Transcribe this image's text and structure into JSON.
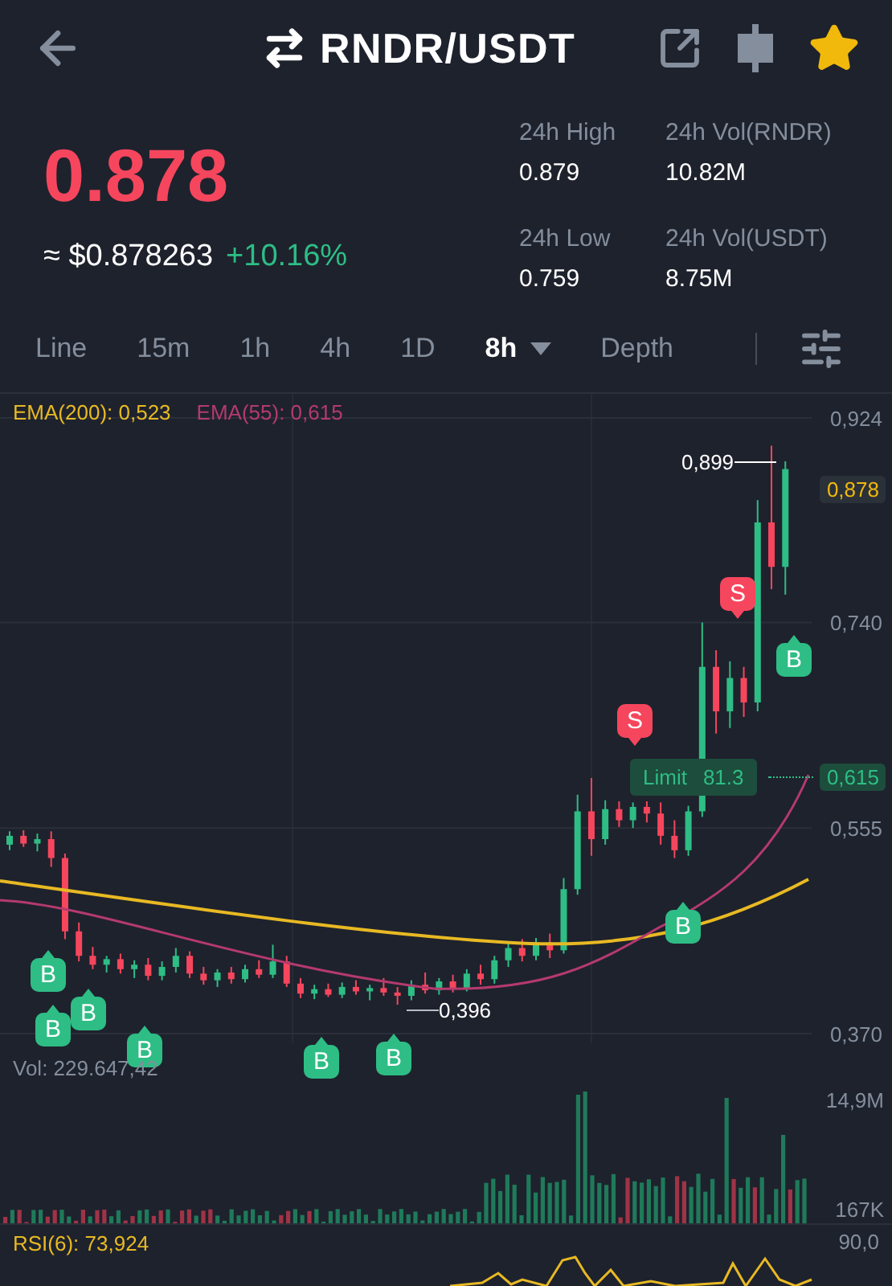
{
  "header": {
    "title": "RNDR/USDT",
    "favorite": true
  },
  "price": {
    "last": "0.878",
    "usd": "≈ $0.878263",
    "change": "+10.16%"
  },
  "stats": [
    {
      "label": "24h High",
      "value": "0.879"
    },
    {
      "label": "24h Vol(RNDR)",
      "value": "10.82M"
    },
    {
      "label": "24h Low",
      "value": "0.759"
    },
    {
      "label": "24h Vol(USDT)",
      "value": "8.75M"
    }
  ],
  "intervals": [
    {
      "label": "Line",
      "selected": false,
      "dropdown": false
    },
    {
      "label": "15m",
      "selected": false,
      "dropdown": false
    },
    {
      "label": "1h",
      "selected": false,
      "dropdown": false
    },
    {
      "label": "4h",
      "selected": false,
      "dropdown": false
    },
    {
      "label": "1D",
      "selected": false,
      "dropdown": false
    },
    {
      "label": "8h",
      "selected": true,
      "dropdown": true
    },
    {
      "label": "Depth",
      "selected": false,
      "dropdown": false
    }
  ],
  "chart": {
    "indicators": [
      {
        "label": "EMA(200): 0,523",
        "color": "#e8b923"
      },
      {
        "label": "EMA(55): 0,615",
        "color": "#b43a6e"
      }
    ],
    "axis": [
      {
        "label": "0,878",
        "kind": "last"
      },
      {
        "label": "0,615",
        "kind": "order"
      }
    ],
    "chart_data": {
      "type": "candlestick",
      "categories": [
        null,
        null,
        null,
        null,
        null,
        null,
        null,
        null,
        null,
        null,
        null,
        null,
        null,
        null,
        null,
        null,
        null,
        null,
        null,
        null,
        null,
        null,
        null,
        null,
        null,
        null,
        null,
        null,
        null,
        null,
        null,
        null,
        null,
        null,
        null,
        null,
        null,
        null,
        null,
        null,
        null,
        null,
        null,
        null,
        null,
        null,
        null,
        null,
        null,
        null,
        null,
        null,
        null,
        null,
        null,
        null,
        null
      ],
      "ylim": [
        0.37,
        0.924
      ],
      "grid": true,
      "yticks": [
        {
          "value": 0.924,
          "label": "0,924"
        },
        {
          "value": 0.74,
          "label": "0,740"
        },
        {
          "value": 0.555,
          "label": "0,555"
        },
        {
          "value": 0.37,
          "label": "0,370"
        }
      ],
      "ohlc": [
        [
          0.54,
          0.552,
          0.535,
          0.548
        ],
        [
          0.548,
          0.553,
          0.538,
          0.541
        ],
        [
          0.541,
          0.55,
          0.534,
          0.545
        ],
        [
          0.545,
          0.552,
          0.52,
          0.528
        ],
        [
          0.528,
          0.532,
          0.455,
          0.462
        ],
        [
          0.462,
          0.47,
          0.435,
          0.44
        ],
        [
          0.44,
          0.448,
          0.428,
          0.432
        ],
        [
          0.432,
          0.44,
          0.425,
          0.437
        ],
        [
          0.437,
          0.442,
          0.424,
          0.428
        ],
        [
          0.428,
          0.436,
          0.42,
          0.432
        ],
        [
          0.432,
          0.438,
          0.418,
          0.422
        ],
        [
          0.422,
          0.435,
          0.418,
          0.43
        ],
        [
          0.43,
          0.447,
          0.425,
          0.44
        ],
        [
          0.44,
          0.444,
          0.42,
          0.424
        ],
        [
          0.424,
          0.43,
          0.414,
          0.418
        ],
        [
          0.418,
          0.428,
          0.412,
          0.425
        ],
        [
          0.425,
          0.43,
          0.415,
          0.419
        ],
        [
          0.419,
          0.432,
          0.416,
          0.428
        ],
        [
          0.428,
          0.436,
          0.42,
          0.423
        ],
        [
          0.423,
          0.45,
          0.42,
          0.435
        ],
        [
          0.435,
          0.44,
          0.412,
          0.415
        ],
        [
          0.415,
          0.42,
          0.402,
          0.406
        ],
        [
          0.406,
          0.414,
          0.401,
          0.41
        ],
        [
          0.41,
          0.415,
          0.403,
          0.405
        ],
        [
          0.405,
          0.416,
          0.402,
          0.412
        ],
        [
          0.412,
          0.418,
          0.405,
          0.408
        ],
        [
          0.408,
          0.414,
          0.4,
          0.411
        ],
        [
          0.411,
          0.42,
          0.404,
          0.407
        ],
        [
          0.407,
          0.412,
          0.396,
          0.404
        ],
        [
          0.404,
          0.418,
          0.4,
          0.414
        ],
        [
          0.414,
          0.425,
          0.406,
          0.409
        ],
        [
          0.409,
          0.42,
          0.405,
          0.417
        ],
        [
          0.417,
          0.423,
          0.407,
          0.411
        ],
        [
          0.411,
          0.428,
          0.408,
          0.424
        ],
        [
          0.424,
          0.432,
          0.414,
          0.419
        ],
        [
          0.419,
          0.44,
          0.415,
          0.436
        ],
        [
          0.436,
          0.452,
          0.43,
          0.447
        ],
        [
          0.447,
          0.455,
          0.435,
          0.44
        ],
        [
          0.44,
          0.456,
          0.436,
          0.452
        ],
        [
          0.452,
          0.46,
          0.438,
          0.445
        ],
        [
          0.445,
          0.51,
          0.442,
          0.5
        ],
        [
          0.5,
          0.585,
          0.495,
          0.57
        ],
        [
          0.57,
          0.6,
          0.53,
          0.545
        ],
        [
          0.545,
          0.58,
          0.54,
          0.572
        ],
        [
          0.572,
          0.579,
          0.556,
          0.562
        ],
        [
          0.562,
          0.578,
          0.555,
          0.574
        ],
        [
          0.574,
          0.579,
          0.56,
          0.568
        ],
        [
          0.568,
          0.578,
          0.54,
          0.548
        ],
        [
          0.548,
          0.562,
          0.528,
          0.535
        ],
        [
          0.535,
          0.575,
          0.53,
          0.57
        ],
        [
          0.57,
          0.74,
          0.565,
          0.7
        ],
        [
          0.7,
          0.715,
          0.64,
          0.66
        ],
        [
          0.66,
          0.705,
          0.645,
          0.69
        ],
        [
          0.69,
          0.7,
          0.655,
          0.668
        ],
        [
          0.668,
          0.85,
          0.66,
          0.83
        ],
        [
          0.83,
          0.899,
          0.77,
          0.79
        ],
        [
          0.79,
          0.885,
          0.765,
          0.878
        ]
      ]
    },
    "high_label": "0,899",
    "low_label": "0,396",
    "order": {
      "label": "Limit",
      "amount": "81.3"
    },
    "markers": [
      {
        "kind": "buy",
        "label": "B"
      },
      {
        "kind": "buy",
        "label": "B"
      },
      {
        "kind": "buy",
        "label": "B"
      },
      {
        "kind": "buy",
        "label": "B"
      },
      {
        "kind": "buy",
        "label": "B"
      },
      {
        "kind": "buy",
        "label": "B"
      },
      {
        "kind": "sell",
        "label": "S"
      },
      {
        "kind": "buy",
        "label": "B"
      },
      {
        "kind": "sell",
        "label": "S"
      },
      {
        "kind": "buy",
        "label": "B"
      }
    ]
  },
  "volume": {
    "label": "Vol: 229.647,42",
    "axis": [
      "14,9M",
      "167K"
    ]
  },
  "rsi": {
    "label": "RSI(6): 73,924",
    "axis": [
      "90,0"
    ]
  }
}
